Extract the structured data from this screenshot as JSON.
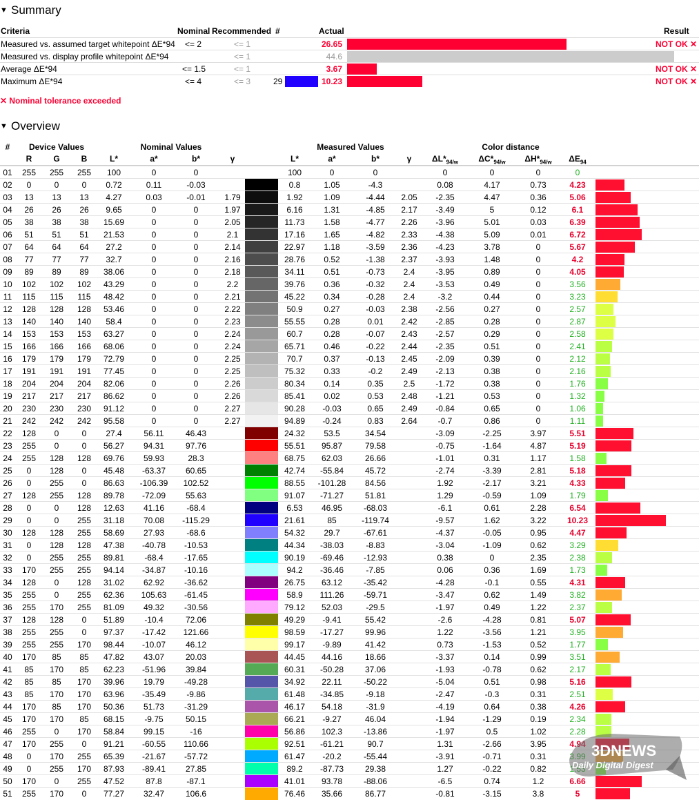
{
  "summary": {
    "title": "Summary",
    "headers": {
      "criteria": "Criteria",
      "nominal": "Nominal",
      "recommended": "Recommended",
      "hash": "#",
      "actual": "Actual",
      "result": "Result"
    },
    "rows": [
      {
        "criteria": "Measured vs. assumed target whitepoint ΔE*94",
        "nominal": "<= 2",
        "recommended": "<= 1",
        "hash": "",
        "actual": "26.65",
        "actual_color": "#ff0033",
        "bar_fraction": 0.67,
        "bar_color": "#ff0033",
        "result": "NOT OK ✕"
      },
      {
        "criteria": "Measured vs. display profile whitepoint ΔE*94",
        "nominal": "",
        "recommended": "<= 1",
        "hash": "",
        "actual": "44.6",
        "actual_color": "#999999",
        "bar_fraction": 1.0,
        "bar_color": "#cccccc",
        "result": ""
      },
      {
        "criteria": "Average ΔE*94",
        "nominal": "<= 1.5",
        "recommended": "<= 1",
        "hash": "",
        "actual": "3.67",
        "actual_color": "#ff0033",
        "bar_fraction": 0.09,
        "bar_color": "#ff0033",
        "result": "NOT OK ✕"
      },
      {
        "criteria": "Maximum ΔE*94",
        "nominal": "<= 4",
        "recommended": "<= 3",
        "hash": "29",
        "swatch": "#2000ff",
        "actual": "10.23",
        "actual_color": "#ff0033",
        "bar_fraction": 0.23,
        "bar_color": "#ff0033",
        "result": "NOT OK ✕"
      }
    ],
    "tolerance_note": "✕ Nominal tolerance exceeded"
  },
  "overview": {
    "title": "Overview",
    "group_headers": {
      "hash": "#",
      "device": "Device Values",
      "nominal": "Nominal Values",
      "measured": "Measured Values",
      "distance": "Color distance"
    },
    "col_headers": {
      "r": "R",
      "g": "G",
      "b": "B",
      "l": "L*",
      "a": "a*",
      "bb": "b*",
      "gamma": "γ",
      "ml": "L*",
      "ma": "a*",
      "mb": "b*",
      "mg": "γ",
      "dl": "ΔL*",
      "dc": "ΔC*",
      "dh": "ΔH*",
      "de": "ΔE",
      "sub1": "94/w",
      "sub2": "94"
    },
    "rows": [
      [
        "01",
        "255",
        "255",
        "255",
        "100",
        "0",
        "0",
        "",
        "#ffffff",
        "100",
        "0",
        "0",
        "",
        "0",
        "0",
        "0",
        "0"
      ],
      [
        "02",
        "0",
        "0",
        "0",
        "0.72",
        "0.11",
        "-0.03",
        "",
        "#000000",
        "0.8",
        "1.05",
        "-4.3",
        "",
        "0.08",
        "4.17",
        "0.73",
        "4.23"
      ],
      [
        "03",
        "13",
        "13",
        "13",
        "4.27",
        "0.03",
        "-0.01",
        "1.79",
        "#0d0d0d",
        "1.92",
        "1.09",
        "-4.44",
        "2.05",
        "-2.35",
        "4.47",
        "0.36",
        "5.06"
      ],
      [
        "04",
        "26",
        "26",
        "26",
        "9.65",
        "0",
        "0",
        "1.97",
        "#1a1a1a",
        "6.16",
        "1.31",
        "-4.85",
        "2.17",
        "-3.49",
        "5",
        "0.12",
        "6.1"
      ],
      [
        "05",
        "38",
        "38",
        "38",
        "15.69",
        "0",
        "0",
        "2.05",
        "#262626",
        "11.73",
        "1.58",
        "-4.77",
        "2.26",
        "-3.96",
        "5.01",
        "0.03",
        "6.39"
      ],
      [
        "06",
        "51",
        "51",
        "51",
        "21.53",
        "0",
        "0",
        "2.1",
        "#333333",
        "17.16",
        "1.65",
        "-4.82",
        "2.33",
        "-4.38",
        "5.09",
        "0.01",
        "6.72"
      ],
      [
        "07",
        "64",
        "64",
        "64",
        "27.2",
        "0",
        "0",
        "2.14",
        "#404040",
        "22.97",
        "1.18",
        "-3.59",
        "2.36",
        "-4.23",
        "3.78",
        "0",
        "5.67"
      ],
      [
        "08",
        "77",
        "77",
        "77",
        "32.7",
        "0",
        "0",
        "2.16",
        "#4d4d4d",
        "28.76",
        "0.52",
        "-1.38",
        "2.37",
        "-3.93",
        "1.48",
        "0",
        "4.2"
      ],
      [
        "09",
        "89",
        "89",
        "89",
        "38.06",
        "0",
        "0",
        "2.18",
        "#595959",
        "34.11",
        "0.51",
        "-0.73",
        "2.4",
        "-3.95",
        "0.89",
        "0",
        "4.05"
      ],
      [
        "10",
        "102",
        "102",
        "102",
        "43.29",
        "0",
        "0",
        "2.2",
        "#666666",
        "39.76",
        "0.36",
        "-0.32",
        "2.4",
        "-3.53",
        "0.49",
        "0",
        "3.56"
      ],
      [
        "11",
        "115",
        "115",
        "115",
        "48.42",
        "0",
        "0",
        "2.21",
        "#737373",
        "45.22",
        "0.34",
        "-0.28",
        "2.4",
        "-3.2",
        "0.44",
        "0",
        "3.23"
      ],
      [
        "12",
        "128",
        "128",
        "128",
        "53.46",
        "0",
        "0",
        "2.22",
        "#808080",
        "50.9",
        "0.27",
        "-0.03",
        "2.38",
        "-2.56",
        "0.27",
        "0",
        "2.57"
      ],
      [
        "13",
        "140",
        "140",
        "140",
        "58.4",
        "0",
        "0",
        "2.23",
        "#8c8c8c",
        "55.55",
        "0.28",
        "0.01",
        "2.42",
        "-2.85",
        "0.28",
        "0",
        "2.87"
      ],
      [
        "14",
        "153",
        "153",
        "153",
        "63.27",
        "0",
        "0",
        "2.24",
        "#999999",
        "60.7",
        "0.28",
        "-0.07",
        "2.43",
        "-2.57",
        "0.29",
        "0",
        "2.58"
      ],
      [
        "15",
        "166",
        "166",
        "166",
        "68.06",
        "0",
        "0",
        "2.24",
        "#a6a6a6",
        "65.71",
        "0.46",
        "-0.22",
        "2.44",
        "-2.35",
        "0.51",
        "0",
        "2.41"
      ],
      [
        "16",
        "179",
        "179",
        "179",
        "72.79",
        "0",
        "0",
        "2.25",
        "#b3b3b3",
        "70.7",
        "0.37",
        "-0.13",
        "2.45",
        "-2.09",
        "0.39",
        "0",
        "2.12"
      ],
      [
        "17",
        "191",
        "191",
        "191",
        "77.45",
        "0",
        "0",
        "2.25",
        "#bfbfbf",
        "75.32",
        "0.33",
        "-0.2",
        "2.49",
        "-2.13",
        "0.38",
        "0",
        "2.16"
      ],
      [
        "18",
        "204",
        "204",
        "204",
        "82.06",
        "0",
        "0",
        "2.26",
        "#cccccc",
        "80.34",
        "0.14",
        "0.35",
        "2.5",
        "-1.72",
        "0.38",
        "0",
        "1.76"
      ],
      [
        "19",
        "217",
        "217",
        "217",
        "86.62",
        "0",
        "0",
        "2.26",
        "#d9d9d9",
        "85.41",
        "0.02",
        "0.53",
        "2.48",
        "-1.21",
        "0.53",
        "0",
        "1.32"
      ],
      [
        "20",
        "230",
        "230",
        "230",
        "91.12",
        "0",
        "0",
        "2.27",
        "#e6e6e6",
        "90.28",
        "-0.03",
        "0.65",
        "2.49",
        "-0.84",
        "0.65",
        "0",
        "1.06"
      ],
      [
        "21",
        "242",
        "242",
        "242",
        "95.58",
        "0",
        "0",
        "2.27",
        "#f2f2f2",
        "94.89",
        "-0.24",
        "0.83",
        "2.64",
        "-0.7",
        "0.86",
        "0",
        "1.11"
      ],
      [
        "22",
        "128",
        "0",
        "0",
        "27.4",
        "56.11",
        "46.43",
        "",
        "#800000",
        "24.32",
        "53.5",
        "34.54",
        "",
        "-3.09",
        "-2.25",
        "3.97",
        "5.51"
      ],
      [
        "23",
        "255",
        "0",
        "0",
        "56.27",
        "94.31",
        "97.76",
        "",
        "#ff0000",
        "55.51",
        "95.87",
        "79.58",
        "",
        "-0.75",
        "-1.64",
        "4.87",
        "5.19"
      ],
      [
        "24",
        "255",
        "128",
        "128",
        "69.76",
        "59.93",
        "28.3",
        "",
        "#ff8080",
        "68.75",
        "62.03",
        "26.66",
        "",
        "-1.01",
        "0.31",
        "1.17",
        "1.58"
      ],
      [
        "25",
        "0",
        "128",
        "0",
        "45.48",
        "-63.37",
        "60.65",
        "",
        "#008000",
        "42.74",
        "-55.84",
        "45.72",
        "",
        "-2.74",
        "-3.39",
        "2.81",
        "5.18"
      ],
      [
        "26",
        "0",
        "255",
        "0",
        "86.63",
        "-106.39",
        "102.52",
        "",
        "#00ff00",
        "88.55",
        "-101.28",
        "84.56",
        "",
        "1.92",
        "-2.17",
        "3.21",
        "4.33"
      ],
      [
        "27",
        "128",
        "255",
        "128",
        "89.78",
        "-72.09",
        "55.63",
        "",
        "#80ff80",
        "91.07",
        "-71.27",
        "51.81",
        "",
        "1.29",
        "-0.59",
        "1.09",
        "1.79"
      ],
      [
        "28",
        "0",
        "0",
        "128",
        "12.63",
        "41.16",
        "-68.4",
        "",
        "#000080",
        "6.53",
        "46.95",
        "-68.03",
        "",
        "-6.1",
        "0.61",
        "2.28",
        "6.54"
      ],
      [
        "29",
        "0",
        "0",
        "255",
        "31.18",
        "70.08",
        "-115.29",
        "",
        "#2000ff",
        "21.61",
        "85",
        "-119.74",
        "",
        "-9.57",
        "1.62",
        "3.22",
        "10.23"
      ],
      [
        "30",
        "128",
        "128",
        "255",
        "58.69",
        "27.93",
        "-68.6",
        "",
        "#8080ff",
        "54.32",
        "29.7",
        "-67.61",
        "",
        "-4.37",
        "-0.05",
        "0.95",
        "4.47"
      ],
      [
        "31",
        "0",
        "128",
        "128",
        "47.38",
        "-40.78",
        "-10.53",
        "",
        "#008080",
        "44.34",
        "-38.03",
        "-8.83",
        "",
        "-3.04",
        "-1.09",
        "0.62",
        "3.29"
      ],
      [
        "32",
        "0",
        "255",
        "255",
        "89.81",
        "-68.4",
        "-17.65",
        "",
        "#00ffff",
        "90.19",
        "-69.46",
        "-12.93",
        "",
        "0.38",
        "0",
        "2.35",
        "2.38"
      ],
      [
        "33",
        "170",
        "255",
        "255",
        "94.14",
        "-34.87",
        "-10.16",
        "",
        "#aaffff",
        "94.2",
        "-36.46",
        "-7.85",
        "",
        "0.06",
        "0.36",
        "1.69",
        "1.73"
      ],
      [
        "34",
        "128",
        "0",
        "128",
        "31.02",
        "62.92",
        "-36.62",
        "",
        "#800080",
        "26.75",
        "63.12",
        "-35.42",
        "",
        "-4.28",
        "-0.1",
        "0.55",
        "4.31"
      ],
      [
        "35",
        "255",
        "0",
        "255",
        "62.36",
        "105.63",
        "-61.45",
        "",
        "#ff00ff",
        "58.9",
        "111.26",
        "-59.71",
        "",
        "-3.47",
        "0.62",
        "1.49",
        "3.82"
      ],
      [
        "36",
        "255",
        "170",
        "255",
        "81.09",
        "49.32",
        "-30.56",
        "",
        "#ffaaff",
        "79.12",
        "52.03",
        "-29.5",
        "",
        "-1.97",
        "0.49",
        "1.22",
        "2.37"
      ],
      [
        "37",
        "128",
        "128",
        "0",
        "51.89",
        "-10.4",
        "72.06",
        "",
        "#808000",
        "49.29",
        "-9.41",
        "55.42",
        "",
        "-2.6",
        "-4.28",
        "0.81",
        "5.07"
      ],
      [
        "38",
        "255",
        "255",
        "0",
        "97.37",
        "-17.42",
        "121.66",
        "",
        "#ffff00",
        "98.59",
        "-17.27",
        "99.96",
        "",
        "1.22",
        "-3.56",
        "1.21",
        "3.95"
      ],
      [
        "39",
        "255",
        "255",
        "170",
        "98.44",
        "-10.07",
        "46.12",
        "",
        "#ffffaa",
        "99.17",
        "-9.89",
        "41.42",
        "",
        "0.73",
        "-1.53",
        "0.52",
        "1.77"
      ],
      [
        "40",
        "170",
        "85",
        "85",
        "47.82",
        "43.07",
        "20.03",
        "",
        "#aa5555",
        "44.45",
        "44.16",
        "18.66",
        "",
        "-3.37",
        "0.14",
        "0.99",
        "3.51"
      ],
      [
        "41",
        "85",
        "170",
        "85",
        "62.23",
        "-51.96",
        "39.84",
        "",
        "#55aa55",
        "60.31",
        "-50.28",
        "37.06",
        "",
        "-1.93",
        "-0.78",
        "0.62",
        "2.17"
      ],
      [
        "42",
        "85",
        "85",
        "170",
        "39.96",
        "19.79",
        "-49.28",
        "",
        "#5555aa",
        "34.92",
        "22.11",
        "-50.22",
        "",
        "-5.04",
        "0.51",
        "0.98",
        "5.16"
      ],
      [
        "43",
        "85",
        "170",
        "170",
        "63.96",
        "-35.49",
        "-9.86",
        "",
        "#55aaaa",
        "61.48",
        "-34.85",
        "-9.18",
        "",
        "-2.47",
        "-0.3",
        "0.31",
        "2.51"
      ],
      [
        "44",
        "170",
        "85",
        "170",
        "50.36",
        "51.73",
        "-31.29",
        "",
        "#aa55aa",
        "46.17",
        "54.18",
        "-31.9",
        "",
        "-4.19",
        "0.64",
        "0.38",
        "4.26"
      ],
      [
        "45",
        "170",
        "170",
        "85",
        "68.15",
        "-9.75",
        "50.15",
        "",
        "#aaaa55",
        "66.21",
        "-9.27",
        "46.04",
        "",
        "-1.94",
        "-1.29",
        "0.19",
        "2.34"
      ],
      [
        "46",
        "255",
        "0",
        "170",
        "58.84",
        "99.15",
        "-16",
        "",
        "#ff00aa",
        "56.86",
        "102.3",
        "-13.86",
        "",
        "-1.97",
        "0.5",
        "1.02",
        "2.28"
      ],
      [
        "47",
        "170",
        "255",
        "0",
        "91.21",
        "-60.55",
        "110.66",
        "",
        "#aaff00",
        "92.51",
        "-61.21",
        "90.7",
        "",
        "1.31",
        "-2.66",
        "3.95",
        "4.94"
      ],
      [
        "48",
        "0",
        "170",
        "255",
        "65.39",
        "-21.67",
        "-57.72",
        "",
        "#00aaff",
        "61.47",
        "-20.2",
        "-55.44",
        "",
        "-3.91",
        "-0.71",
        "0.31",
        "3.99"
      ],
      [
        "49",
        "0",
        "255",
        "170",
        "87.93",
        "-89.41",
        "27.85",
        "",
        "#00ffaa",
        "89.2",
        "-87.73",
        "29.38",
        "",
        "1.27",
        "-0.22",
        "0.82",
        "1.53"
      ],
      [
        "50",
        "170",
        "0",
        "255",
        "47.52",
        "87.8",
        "-87.1",
        "",
        "#aa00ff",
        "41.01",
        "93.78",
        "-88.06",
        "",
        "-6.5",
        "0.74",
        "1.2",
        "6.66"
      ],
      [
        "51",
        "255",
        "170",
        "0",
        "77.27",
        "32.47",
        "106.6",
        "",
        "#ffaa00",
        "76.46",
        "35.66",
        "86.77",
        "",
        "-0.81",
        "-3.15",
        "3.8",
        "5"
      ]
    ]
  },
  "watermark": {
    "brand": "3DNEWS",
    "tagline": "Daily Digital Digest"
  }
}
